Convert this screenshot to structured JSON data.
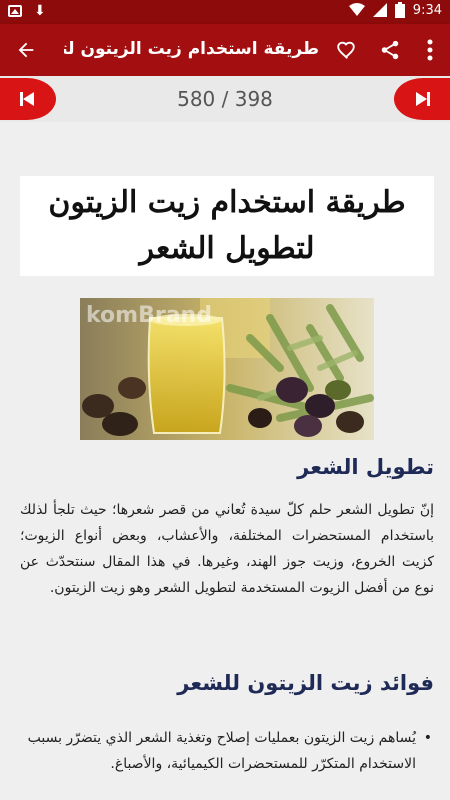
{
  "status_bar": {
    "time": "9:34",
    "icons": [
      "image-notification-icon",
      "download-icon",
      "wifi-icon",
      "signal-icon",
      "battery-icon"
    ]
  },
  "app_bar": {
    "title": "طريقة استخدام زيت الزيتون لتطوي..",
    "icons": [
      "back-arrow-icon",
      "heart-icon",
      "share-icon",
      "more-vert-icon"
    ]
  },
  "pager": {
    "counter": "580 / 398"
  },
  "article": {
    "title": "طريقة استخدام زيت الزيتون لتطويل الشعر",
    "image_watermark": "komBrand",
    "section1_heading": "تطويل الشعر",
    "section1_paragraph": "إنّ تطويل الشعر حلم كلّ سيدة تُعاني من قصر شعرها؛ حيث تلجأ لذلك باستخدام المستحضرات المختلفة، والأعشاب، وبعض أنواع الزيوت؛ كزيت الخروع، وزيت جوز الهند، وغيرها. في هذا المقال سنتحدّث عن نوع من أفضل الزيوت المستخدمة لتطويل الشعر وهو زيت الزيتون.",
    "section2_heading": "فوائد زيت الزيتون للشعر",
    "bullet1": "يُساهم زيت الزيتون بعمليات إصلاح وتغذية الشعر الذي يتضرّر بسبب الاستخدام المتكرّر للمستحضرات الكيميائية، والأصباغ."
  },
  "colors": {
    "status_bar": "#8d0b0b",
    "app_bar": "#a30f10",
    "pager_button": "#d81414",
    "heading": "#1f2a56"
  }
}
